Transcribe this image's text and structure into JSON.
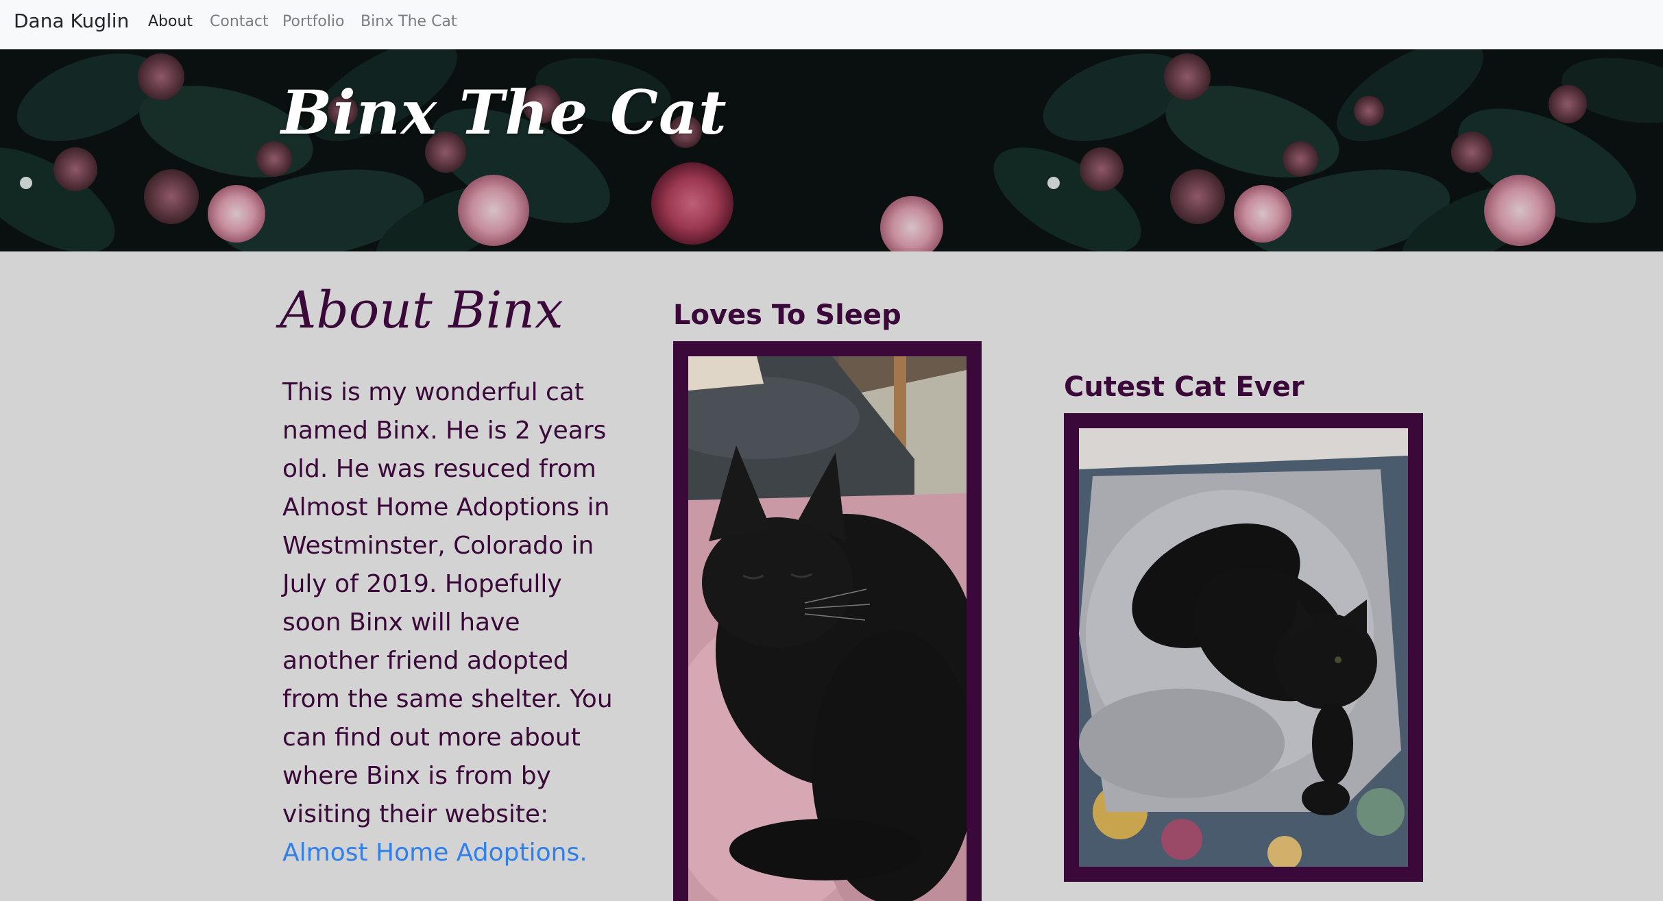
{
  "navbar": {
    "brand": "Dana Kuglin",
    "links": [
      {
        "label": "About",
        "active": true
      },
      {
        "label": "Contact",
        "active": false
      },
      {
        "label": "Portfolio",
        "active": false
      },
      {
        "label": "Binx The Cat",
        "active": false
      }
    ]
  },
  "hero": {
    "title": "Binx The Cat"
  },
  "about": {
    "heading": "About Binx",
    "body": "This is my wonderful cat named Binx. He is 2 years old. He was resuced from Almost Home Adoptions in Westminster, Colorado in July of 2019. Hopefully soon Binx will have another friend adopted from the same shelter. You can find out more about where Binx is from by visiting their website: ",
    "link_text": "Almost Home Adoptions."
  },
  "photos": [
    {
      "title": "Loves To Sleep",
      "image": "black cat sleeping on pink blanket"
    },
    {
      "title": "Cutest Cat Ever",
      "image": "black cat lying on fluffy blanket"
    }
  ],
  "colors": {
    "accent": "#3a0839",
    "link": "#2f80ed",
    "background": "#d3d3d3",
    "navbar": "#f8f9fa"
  }
}
